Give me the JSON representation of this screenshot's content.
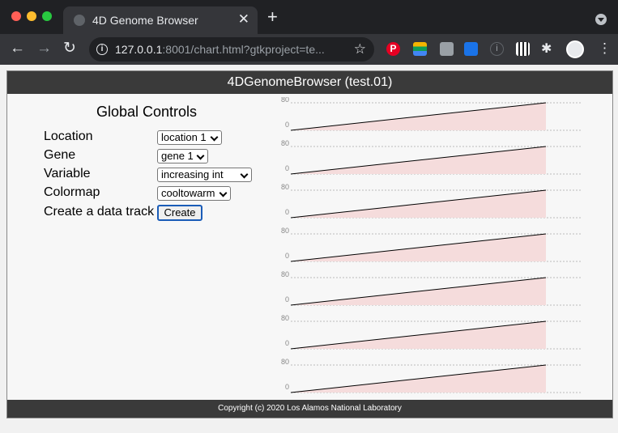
{
  "browser": {
    "tab_title": "4D Genome Browser",
    "url_host": "127.0.0.1",
    "url_rest": ":8001/chart.html?gtkproject=te..."
  },
  "app": {
    "title": "4DGenomeBrowser (test.01)",
    "footer": "Copyright (c) 2020 Los Alamos National Laboratory"
  },
  "controls": {
    "heading": "Global Controls",
    "location_label": "Location",
    "location_value": "location 1",
    "gene_label": "Gene",
    "gene_value": "gene 1",
    "variable_label": "Variable",
    "variable_value": "increasing int",
    "colormap_label": "Colormap",
    "colormap_value": "cooltowarm",
    "create_label": "Create a data track",
    "create_button": "Create"
  },
  "chart_data": {
    "type": "area",
    "track_count": 7,
    "ylim": [
      0,
      80
    ],
    "y_tick_labels": [
      "80",
      "0"
    ],
    "tracks": [
      {
        "x": [
          0,
          1
        ],
        "y": [
          0,
          80
        ]
      },
      {
        "x": [
          0,
          1
        ],
        "y": [
          0,
          80
        ]
      },
      {
        "x": [
          0,
          1
        ],
        "y": [
          0,
          80
        ]
      },
      {
        "x": [
          0,
          1
        ],
        "y": [
          0,
          80
        ]
      },
      {
        "x": [
          0,
          1
        ],
        "y": [
          0,
          80
        ]
      },
      {
        "x": [
          0,
          1
        ],
        "y": [
          0,
          80
        ]
      },
      {
        "x": [
          0,
          1
        ],
        "y": [
          0,
          80
        ]
      }
    ],
    "fill_color": "#f5dcdc",
    "line_color": "#000000",
    "grid": true
  }
}
